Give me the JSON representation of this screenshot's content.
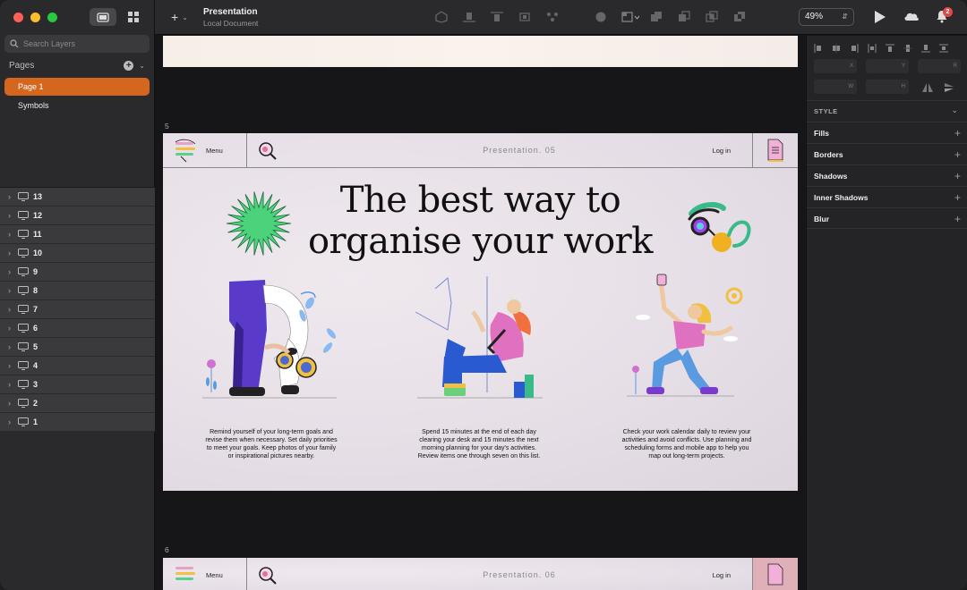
{
  "sidebar": {
    "search_placeholder": "Search Layers",
    "pages_label": "Pages",
    "pages": [
      {
        "label": "Page 1",
        "selected": true
      },
      {
        "label": "Symbols",
        "selected": false
      }
    ],
    "layers": [
      "13",
      "12",
      "11",
      "10",
      "9",
      "8",
      "7",
      "6",
      "5",
      "4",
      "3",
      "2",
      "1"
    ]
  },
  "toolbar": {
    "doc_title": "Presentation",
    "doc_subtitle": "Local Document",
    "zoom": "49%",
    "notification_count": "2"
  },
  "canvas": {
    "artboard5_label": "5",
    "artboard6_label": "6",
    "slide5": {
      "menu": "Menu",
      "title": "Presentation. 05",
      "login": "Log in",
      "headline_line1": "The best way to",
      "headline_line2": "organise your work",
      "captions": [
        "Remind yourself of your long-term goals and revise them when necessary. Set daily priorities to meet your goals. Keep photos of your family or inspirational pictures nearby.",
        "Spend 15 minutes at the end of each day clearing your desk and 15 minutes the next morning planning for your day's activities. Review items one through seven on this list.",
        "Check your work calendar daily to review your activities and avoid conflicts. Use planning and scheduling forms and mobile app to help you map out long-term projects."
      ]
    },
    "slide6": {
      "menu": "Menu",
      "title": "Presentation. 06",
      "login": "Log in"
    }
  },
  "inspector": {
    "fields": [
      "X",
      "Y",
      "R",
      "W",
      "H"
    ],
    "style_label": "STYLE",
    "sections": [
      "Fills",
      "Borders",
      "Shadows",
      "Inner Shadows",
      "Blur"
    ]
  },
  "colors": {
    "accent": "#d4661e",
    "sidebar_bg": "#2a2a2c",
    "layer_row_bg": "#3a3a3c",
    "canvas_bg": "#161618"
  }
}
